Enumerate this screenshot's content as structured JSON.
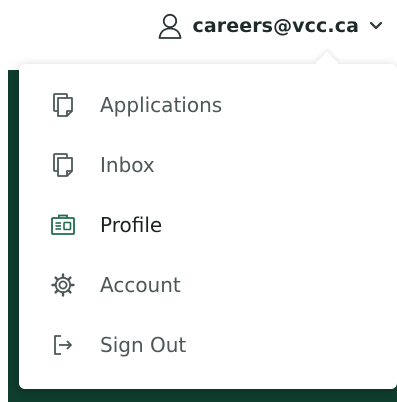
{
  "header": {
    "user_email": "careers@vcc.ca",
    "user_icon": "user-icon",
    "toggle_icon": "chevron-down-icon"
  },
  "menu": {
    "items": [
      {
        "label": "Applications",
        "icon": "document-icon",
        "active": false
      },
      {
        "label": "Inbox",
        "icon": "document-icon",
        "active": false
      },
      {
        "label": "Profile",
        "icon": "id-card-icon",
        "active": true
      },
      {
        "label": "Account",
        "icon": "gear-icon",
        "active": false
      },
      {
        "label": "Sign Out",
        "icon": "sign-out-icon",
        "active": false
      }
    ]
  },
  "colors": {
    "active_icon": "#1e6b4a",
    "inactive_icon": "#4d5757",
    "background_panel": "#0f3d2e"
  }
}
